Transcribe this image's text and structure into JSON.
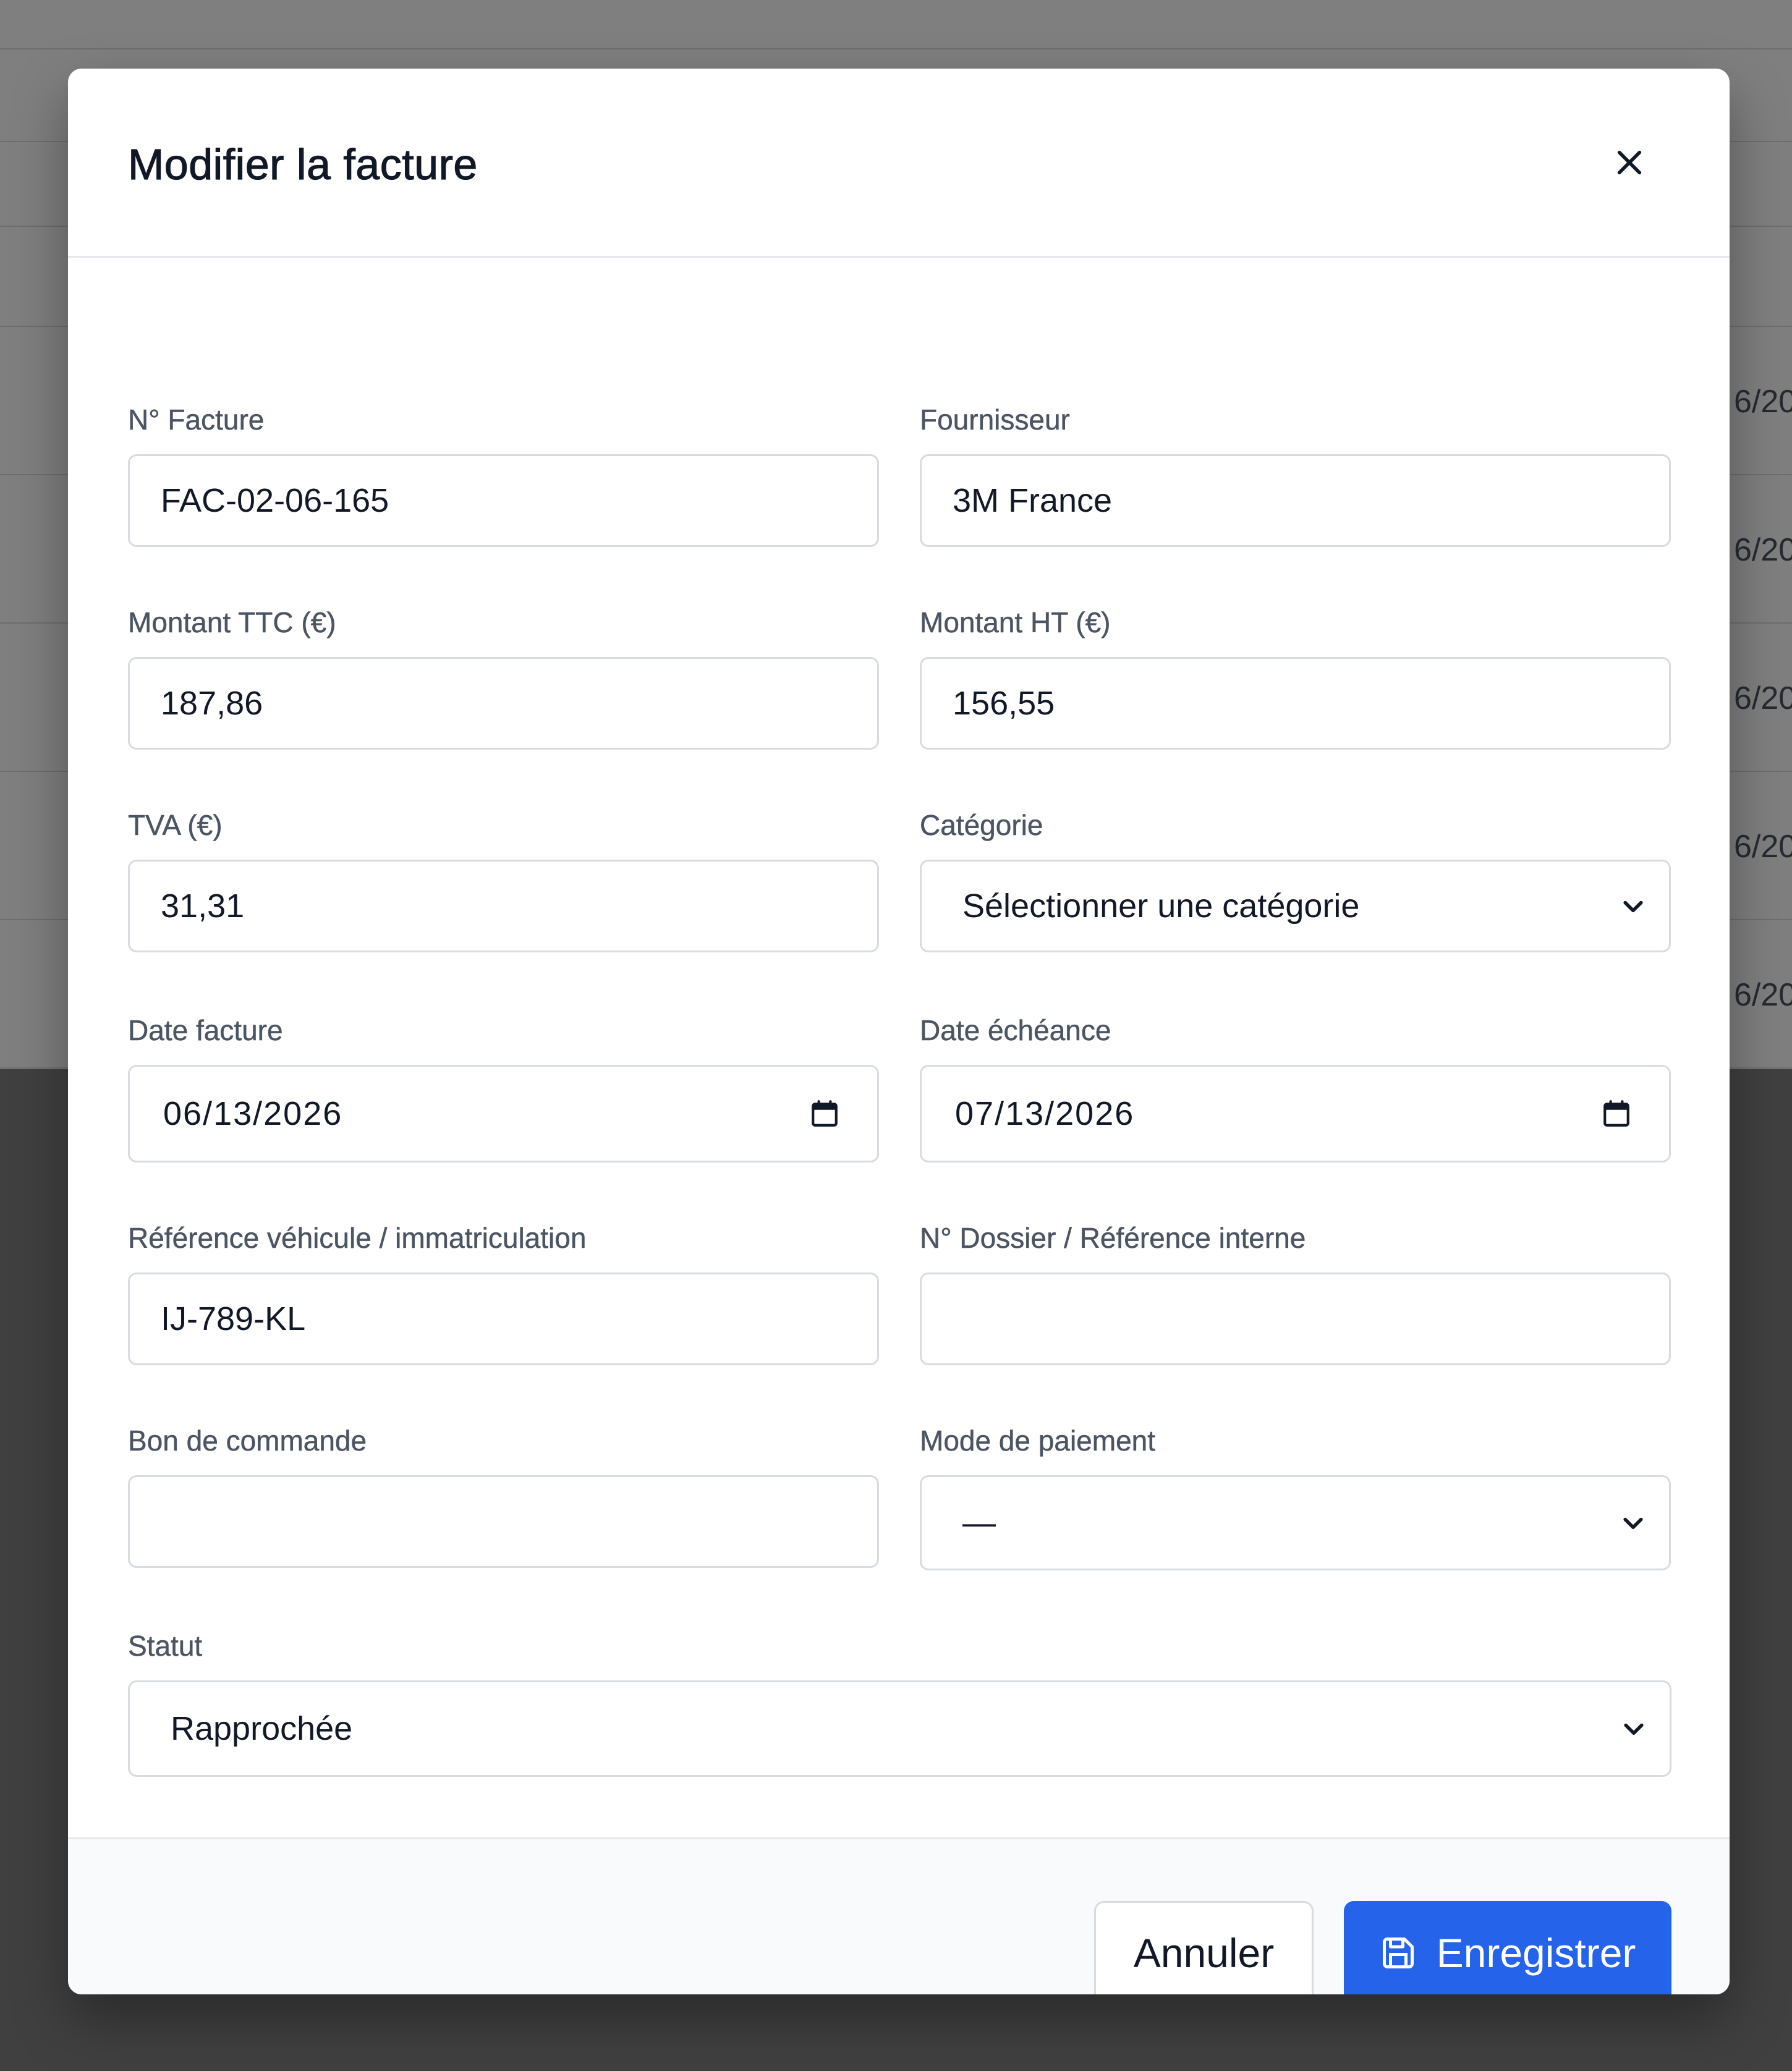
{
  "background": {
    "row_dates": [
      "6/20",
      "6/20",
      "6/20",
      "6/20",
      "6/20"
    ]
  },
  "modal": {
    "title": "Modifier la facture",
    "close_icon": "close-icon"
  },
  "form": {
    "invoice_number": {
      "label": "N° Facture",
      "value": "FAC-02-06-165"
    },
    "supplier": {
      "label": "Fournisseur",
      "value": "3M France"
    },
    "amount_ttc": {
      "label": "Montant TTC (€)",
      "value": "187,86"
    },
    "amount_ht": {
      "label": "Montant HT (€)",
      "value": "156,55"
    },
    "vat": {
      "label": "TVA (€)",
      "value": "31,31"
    },
    "category": {
      "label": "Catégorie",
      "selected": "Sélectionner une catégorie"
    },
    "invoice_date": {
      "label": "Date facture",
      "value": "06/13/2026"
    },
    "due_date": {
      "label": "Date échéance",
      "value": "07/13/2026"
    },
    "vehicle_ref": {
      "label": "Référence véhicule / immatriculation",
      "value": "IJ-789-KL"
    },
    "file_ref": {
      "label": "N° Dossier / Référence interne",
      "value": ""
    },
    "purchase_order": {
      "label": "Bon de commande",
      "value": ""
    },
    "payment_mode": {
      "label": "Mode de paiement",
      "selected": "—"
    },
    "status": {
      "label": "Statut",
      "selected": "Rapprochée"
    }
  },
  "footer": {
    "cancel_label": "Annuler",
    "save_label": "Enregistrer"
  },
  "colors": {
    "primary": "#2563eb",
    "overlay": "#808080"
  }
}
